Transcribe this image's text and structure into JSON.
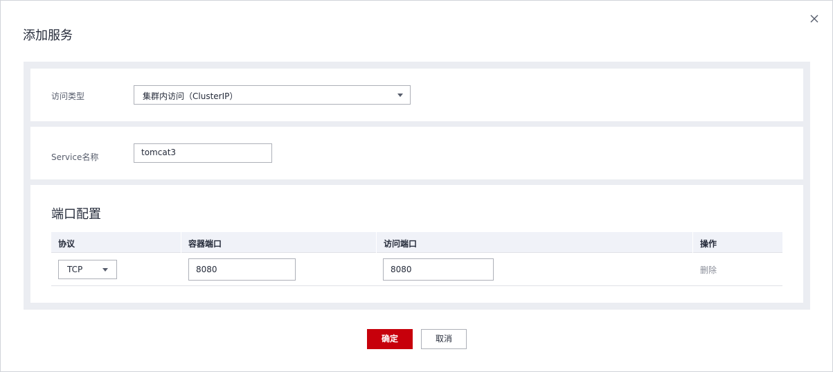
{
  "dialog": {
    "title": "添加服务",
    "close_icon": "close-icon"
  },
  "access_type": {
    "label": "访问类型",
    "value": "集群内访问（ClusterIP）"
  },
  "service_name": {
    "label": "Service名称",
    "value": "tomcat3"
  },
  "port_config": {
    "title": "端口配置",
    "columns": [
      "协议",
      "容器端口",
      "访问端口",
      "操作"
    ],
    "rows": [
      {
        "protocol": "TCP",
        "container_port": "8080",
        "access_port": "8080",
        "action": "删除"
      }
    ]
  },
  "footer": {
    "ok_label": "确定",
    "cancel_label": "取消"
  },
  "colors": {
    "primary": "#c7000b",
    "panel_bg": "#ebedf2",
    "table_header_bg": "#f0f2f8"
  }
}
